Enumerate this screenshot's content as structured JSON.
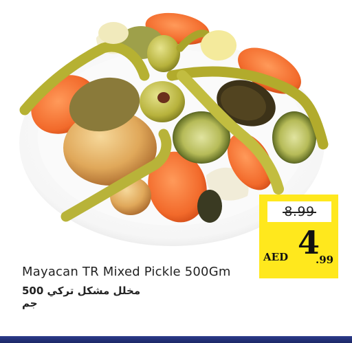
{
  "product": {
    "name_en": "Mayacan TR Mixed Pickle 500Gm",
    "name_ar": "مخلل مشكل تركي 500 جم",
    "image_icon": "mixed-pickle-plate-image"
  },
  "price": {
    "old": "8.99",
    "currency": "AED",
    "new_int": "4",
    "new_dec": ".99"
  },
  "colors": {
    "tag_yellow": "#ffe81d",
    "brand_blue": "#1b2766"
  }
}
